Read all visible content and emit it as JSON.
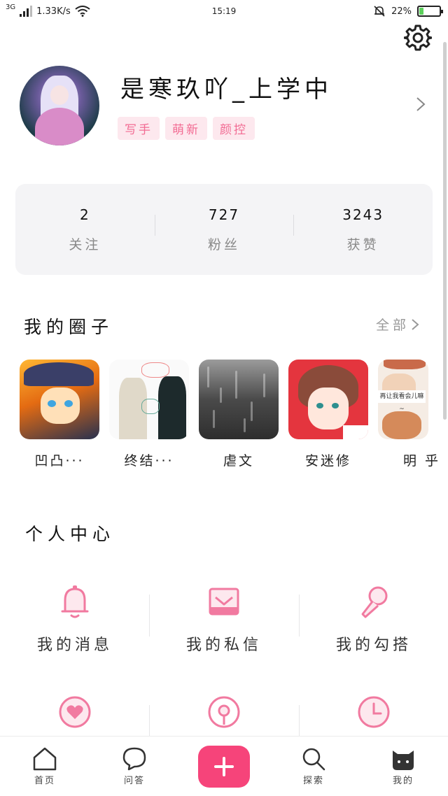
{
  "status_bar": {
    "network_type": "3G",
    "speed": "1.33K/s",
    "time": "15:19",
    "battery": "22%",
    "battery_level": 0.22,
    "battery_color": "#5cd05c",
    "icons": [
      "signal-icon",
      "wifi-icon",
      "mute-bell-icon",
      "battery-icon"
    ]
  },
  "profile": {
    "username": "是寒玖吖_上学中",
    "tags": [
      "写手",
      "萌新",
      "颜控"
    ],
    "icons": [
      "avatar",
      "chevron-right-icon",
      "gear-icon"
    ]
  },
  "stats": [
    {
      "value": "2",
      "label": "关注"
    },
    {
      "value": "727",
      "label": "粉丝"
    },
    {
      "value": "3243",
      "label": "获赞"
    }
  ],
  "circles_section": {
    "title": "我的圈子",
    "see_all": "全部",
    "items": [
      {
        "name": "凹凸···"
      },
      {
        "name": "终结···"
      },
      {
        "name": "虐文"
      },
      {
        "name": "安迷修"
      },
      {
        "name": "明 乎"
      }
    ],
    "thumb5_text": "再让我看会儿嘛~"
  },
  "personal_center": {
    "title": "个人中心",
    "items": [
      {
        "label": "我的消息",
        "icon": "bell-icon"
      },
      {
        "label": "我的私信",
        "icon": "mail-icon"
      },
      {
        "label": "我的勾搭",
        "icon": "microphone-icon"
      },
      {
        "label": "",
        "icon": "heart-icon"
      },
      {
        "label": "",
        "icon": "broadcast-icon"
      },
      {
        "label": "",
        "icon": "clock-icon"
      }
    ]
  },
  "tab_bar": {
    "tabs": [
      {
        "label": "首页",
        "icon": "home-icon"
      },
      {
        "label": "问答",
        "icon": "chat-bubble-icon"
      },
      {
        "label": "",
        "icon": "plus-icon"
      },
      {
        "label": "探索",
        "icon": "search-icon"
      },
      {
        "label": "我的",
        "icon": "cat-icon"
      }
    ]
  },
  "colors": {
    "accent": "#f6447a",
    "accent_light": "#fde8ee",
    "icon_pink": "#f17aa0",
    "text_gray": "#888888"
  }
}
